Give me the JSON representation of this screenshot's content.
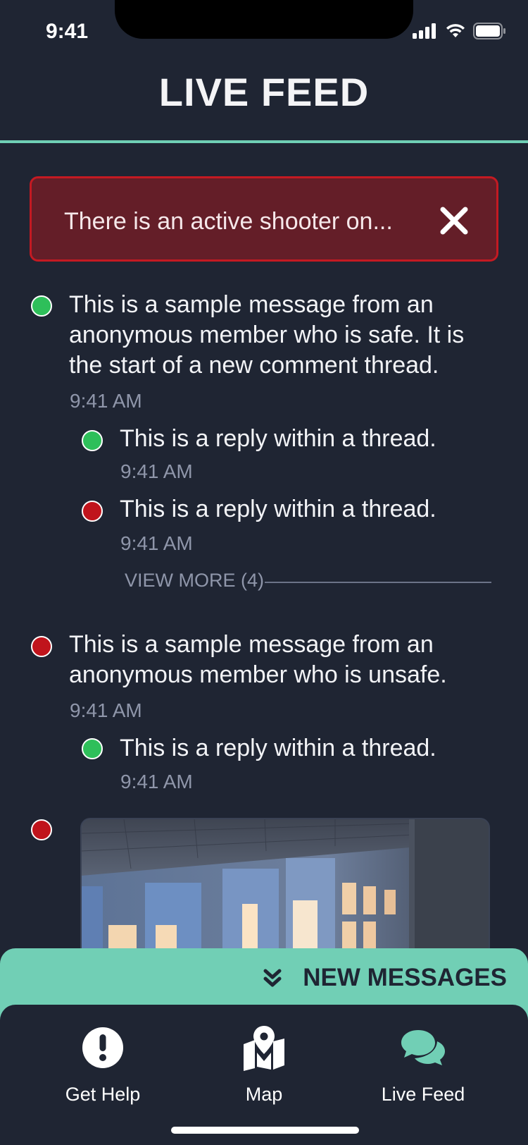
{
  "status_bar": {
    "time": "9:41"
  },
  "header": {
    "title": "LIVE FEED",
    "accent": "#6fcfb5"
  },
  "alert": {
    "text": "There is an active shooter on...",
    "close_icon": "close-icon"
  },
  "colors": {
    "safe": "#2ebf5a",
    "unsafe": "#c0141c",
    "background": "#1f2533",
    "alert_bg": "#641e28"
  },
  "feed": {
    "thread1": {
      "status": "safe",
      "lines": [
        "This is a sample message from an",
        "anonymous member who is safe. It is",
        "the start of a new comment thread."
      ],
      "time": "9:41 AM",
      "replies": [
        {
          "status": "safe",
          "text": "This is a reply within a thread.",
          "time": "9:41 AM"
        },
        {
          "status": "unsafe",
          "text": "This is a reply within a thread.",
          "time": "9:41 AM"
        }
      ],
      "view_more": "VIEW MORE (4)"
    },
    "thread2": {
      "status": "unsafe",
      "lines": [
        "This is a sample message from an",
        "anonymous member who is unsafe."
      ],
      "time": "9:41 AM",
      "replies": [
        {
          "status": "safe",
          "text": "This is a reply within a thread.",
          "time": "9:41 AM"
        }
      ]
    },
    "thread3": {
      "status": "unsafe"
    }
  },
  "new_messages": {
    "label": "NEW MESSAGES"
  },
  "tabs": [
    {
      "label": "Get Help",
      "icon": "exclamation-circle-icon"
    },
    {
      "label": "Map",
      "icon": "map-pin-icon"
    },
    {
      "label": "Live Feed",
      "icon": "chat-bubbles-icon",
      "active": true
    }
  ]
}
